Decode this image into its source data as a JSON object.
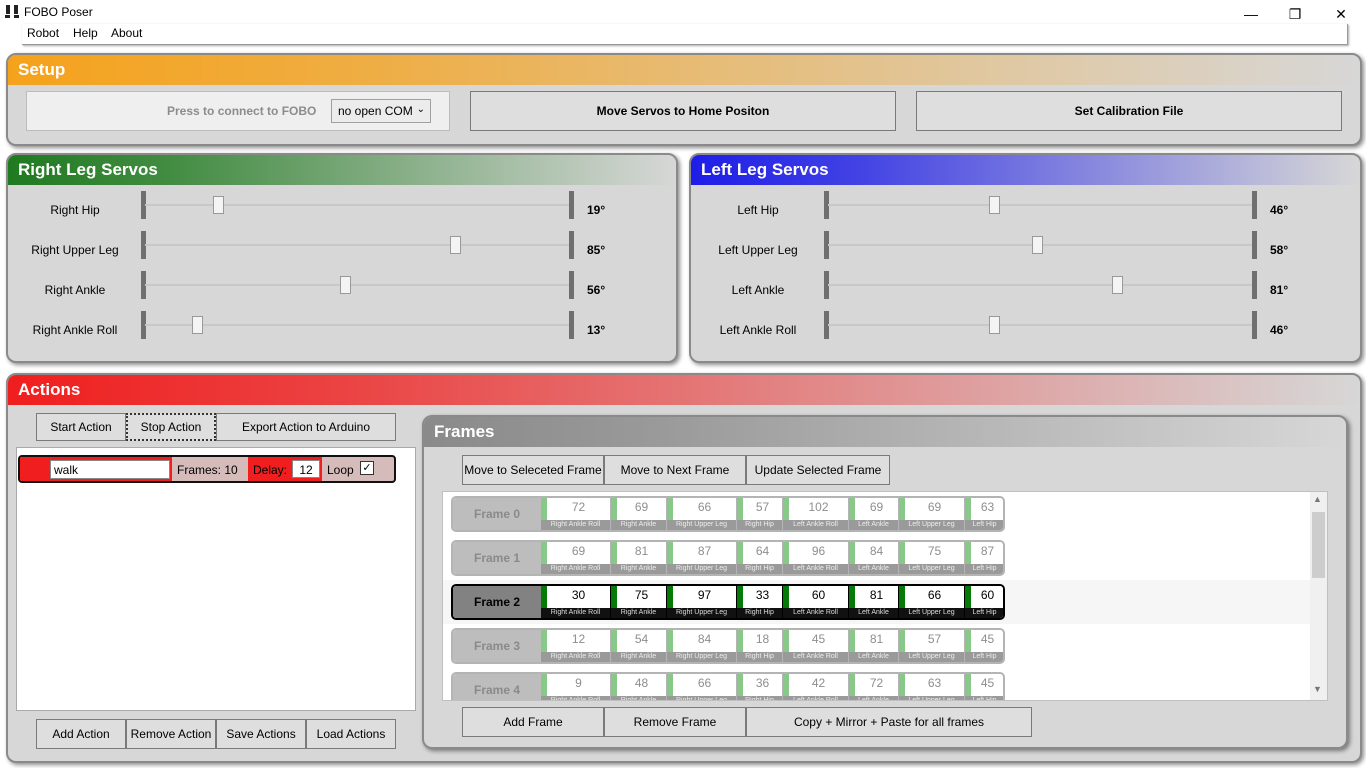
{
  "window": {
    "title": "FOBO Poser",
    "minimize": "—",
    "maximize": "❐",
    "close": "✕"
  },
  "menu": [
    "Robot",
    "Help",
    "About"
  ],
  "setup": {
    "title": "Setup",
    "connect_label": "Press to connect to FOBO",
    "com_value": "no open COM",
    "home_button": "Move Servos to Home Positon",
    "calibration_button": "Set Calibration File"
  },
  "right_leg": {
    "title": "Right Leg Servos",
    "servos": [
      {
        "label": "Right Hip",
        "value": "19°",
        "level": 0.16
      },
      {
        "label": "Right Upper Leg",
        "value": "85°",
        "level": 0.72
      },
      {
        "label": "Right Ankle",
        "value": "56°",
        "level": 0.46
      },
      {
        "label": "Right Ankle Roll",
        "value": "13°",
        "level": 0.11
      }
    ]
  },
  "left_leg": {
    "title": "Left Leg Servos",
    "servos": [
      {
        "label": "Left Hip",
        "value": "46°",
        "level": 0.38
      },
      {
        "label": "Left Upper Leg",
        "value": "58°",
        "level": 0.48
      },
      {
        "label": "Left Ankle",
        "value": "81°",
        "level": 0.67
      },
      {
        "label": "Left Ankle Roll",
        "value": "46°",
        "level": 0.38
      }
    ]
  },
  "actions": {
    "title": "Actions",
    "start_button": "Start Action",
    "stop_button": "Stop Action",
    "export_button": "Export Action to Arduino",
    "row": {
      "name": "walk",
      "frames_label": "Frames: 10",
      "delay_label": "Delay:",
      "delay_value": "12",
      "loop_label": "Loop",
      "loop_checked": "✓"
    },
    "add_button": "Add Action",
    "remove_button": "Remove Action",
    "save_button": "Save Actions",
    "load_button": "Load Actions"
  },
  "frames": {
    "title": "Frames",
    "move_selected_button": "Move to Seleceted Frame",
    "move_next_button": "Move to Next Frame",
    "update_button": "Update Selected Frame",
    "add_button": "Add Frame",
    "remove_button": "Remove Frame",
    "mirror_button": "Copy + Mirror + Paste for all frames",
    "cell_labels": [
      "Right Ankle Roll",
      "Right Ankle",
      "Right Upper Leg",
      "Right Hip",
      "Left Ankle Roll",
      "Left Ankle",
      "Left Upper Leg",
      "Left Hip"
    ],
    "rows": [
      {
        "label": "Frame 0",
        "values": [
          "72",
          "69",
          "66",
          "57",
          "102",
          "69",
          "69",
          "63"
        ],
        "selected": false
      },
      {
        "label": "Frame 1",
        "values": [
          "69",
          "81",
          "87",
          "64",
          "96",
          "84",
          "75",
          "87"
        ],
        "selected": false
      },
      {
        "label": "Frame 2",
        "values": [
          "30",
          "75",
          "97",
          "33",
          "60",
          "81",
          "66",
          "60"
        ],
        "selected": true
      },
      {
        "label": "Frame 3",
        "values": [
          "12",
          "54",
          "84",
          "18",
          "45",
          "81",
          "57",
          "45"
        ],
        "selected": false
      },
      {
        "label": "Frame 4",
        "values": [
          "9",
          "48",
          "66",
          "36",
          "42",
          "72",
          "63",
          "45"
        ],
        "selected": false
      }
    ]
  },
  "colors": {
    "setup": "#f5a21b",
    "right_leg": "#1f7a1f",
    "left_leg": "#1d1de8",
    "actions": "#f01e1e",
    "frames": "#8a8a8a"
  }
}
